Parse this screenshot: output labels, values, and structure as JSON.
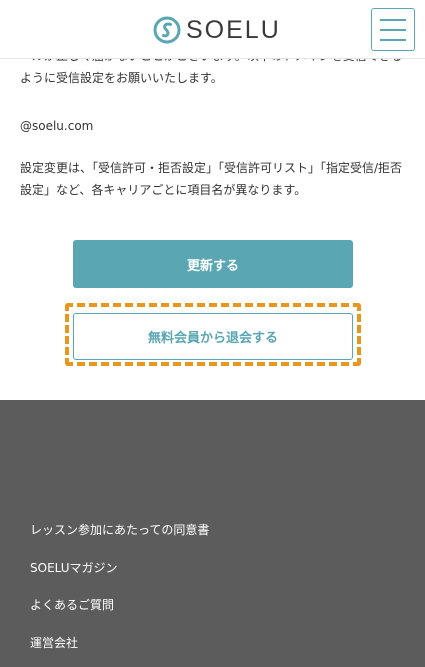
{
  "header": {
    "logo_text": "SOELU",
    "logo_mark_icon": "soelu-s-mark",
    "menu_icon": "hamburger-menu-icon",
    "accent_color": "#5aa6b3"
  },
  "content": {
    "paragraph_partial": "ールが正しく届かないことがございます。以下のドメインを受信できるように受信設定をお願いいたします。",
    "domain": "@soelu.com",
    "note": "設定変更は、「受信許可・拒否設定」「受信許可リスト」「指定受信/拒否設定」など、各キャリアごとに項目名が異なります。"
  },
  "buttons": {
    "update_label": "更新する",
    "withdraw_label": "無料会員から退会する",
    "highlight_color": "#e8961c"
  },
  "footer": {
    "links": [
      "レッスン参加にあたっての同意書",
      "SOELUマガジン",
      "よくあるご質問",
      "運営会社"
    ],
    "background_color": "#5c5c5c"
  }
}
